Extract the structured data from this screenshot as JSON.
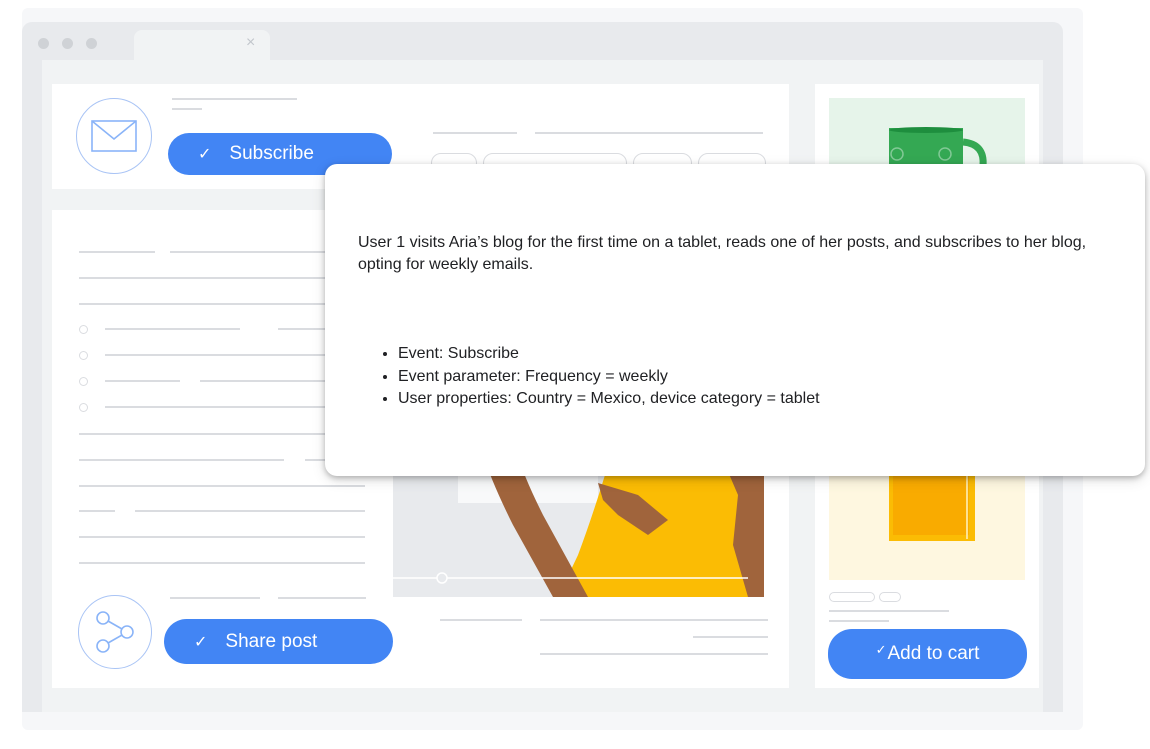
{
  "subscribe_button": {
    "label": "Subscribe",
    "check": "✓"
  },
  "share_button": {
    "label": "Share post",
    "check": "✓"
  },
  "cart_button": {
    "label": "Add to cart",
    "check": "✓"
  },
  "tab": {
    "close": "×"
  },
  "popup": {
    "description": "User 1 visits Aria’s blog for the first time on a tablet, reads one of her posts, and subscribes to her blog, opting for weekly emails.",
    "bullets": [
      "Event: Subscribe",
      "Event parameter: Frequency = weekly",
      "User properties: Country = Mexico, device category = tablet"
    ]
  },
  "colors": {
    "accent": "#4285f4",
    "mug": "#34a853",
    "book": "#fbbc04",
    "skin": "#a0643c"
  },
  "icons": [
    "envelope-icon",
    "share-icon",
    "mug-image",
    "book-image"
  ]
}
